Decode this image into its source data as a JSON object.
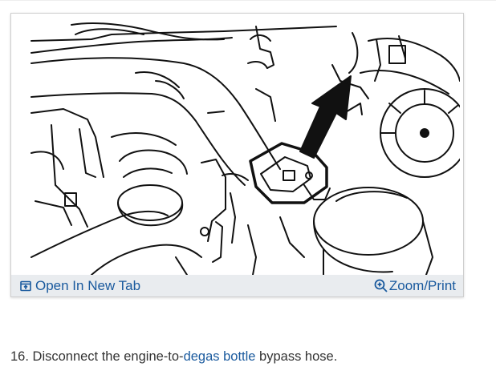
{
  "figure": {
    "open_tab_label": "Open In New Tab",
    "zoom_label": "Zoom/Print",
    "icons": {
      "open_tab": "open-in-new-tab-icon",
      "zoom": "zoom-magnifier-icon",
      "illustration": "engine-hose-diagram",
      "arrow": "pointer-arrow"
    },
    "footer_bg": "#e9ecef",
    "link_color": "#1a5a9e"
  },
  "step": {
    "number": "16.",
    "text_before": " Disconnect the engine-to-",
    "link_text": "degas bottle",
    "text_after": " bypass hose."
  }
}
